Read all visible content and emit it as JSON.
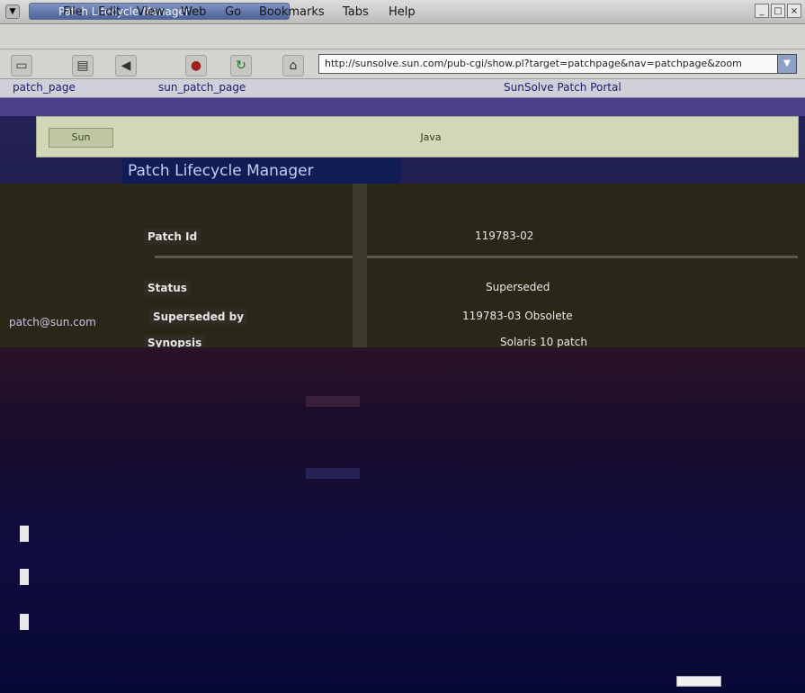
{
  "window": {
    "title": "Patch Lifecycle Manager"
  },
  "menubar": {
    "items": [
      "File",
      "Edit",
      "View",
      "Web",
      "Go",
      "Bookmarks",
      "Tabs",
      "Help"
    ]
  },
  "toolbar": {
    "url": "http://sunsolve.sun.com/pub-cgi/show.pl?target=patchpage&nav=patchpage&zoom"
  },
  "bookmarks": {
    "items": [
      "patch_page",
      "sun_patch_page",
      "SunSolve Patch Portal"
    ]
  },
  "header": {
    "logo_left": "Sun",
    "logo_right": "Java",
    "page_title": "Patch Lifecycle Manager"
  },
  "sidebar": {
    "link": "patch@sun.com"
  },
  "form": {
    "rows": [
      {
        "label": "Patch Id",
        "value": "119783-02"
      },
      {
        "label": "Status",
        "value": "Superseded"
      },
      {
        "label": "Superseded by",
        "value": "119783-03 Obsolete"
      },
      {
        "label": "Synopsis",
        "value": "Solaris 10 patch"
      }
    ]
  }
}
